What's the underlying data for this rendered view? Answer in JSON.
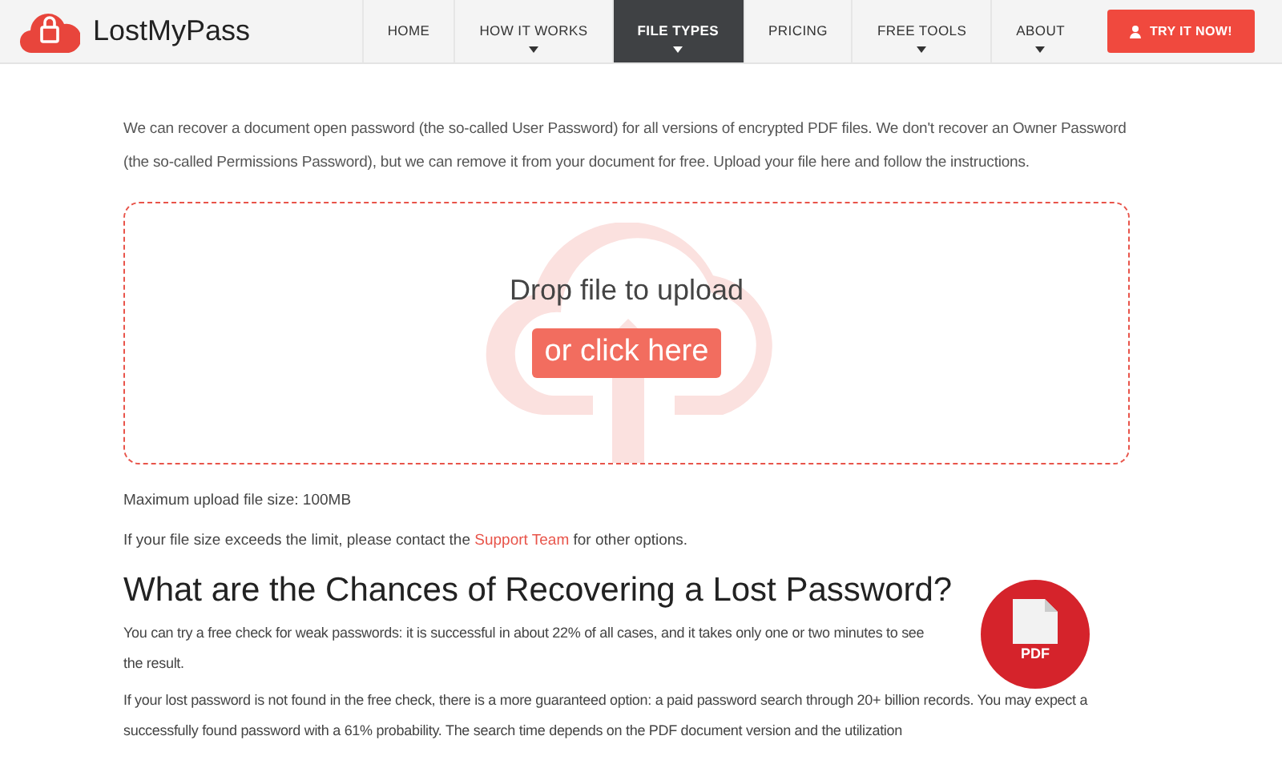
{
  "logo": {
    "text": "LostMyPass"
  },
  "nav": [
    {
      "label": "HOME",
      "selected": false,
      "dropdown": false
    },
    {
      "label": "HOW IT WORKS",
      "selected": false,
      "dropdown": true
    },
    {
      "label": "FILE TYPES",
      "selected": true,
      "dropdown": true
    },
    {
      "label": "PRICING",
      "selected": false,
      "dropdown": false
    },
    {
      "label": "FREE TOOLS",
      "selected": false,
      "dropdown": true
    },
    {
      "label": "ABOUT",
      "selected": false,
      "dropdown": true
    }
  ],
  "cta": {
    "label": "TRY IT NOW!"
  },
  "intro": "We can recover a document open password (the so-called User Password) for all versions of encrypted PDF files. We don't recover an Owner Password (the so-called Permissions Password), but we can remove it from your document for free. Upload your file here and follow the instructions.",
  "dropzone": {
    "title": "Drop file to upload",
    "button": "or click here"
  },
  "max_size": "Maximum upload file size: 100MB",
  "limit_note": {
    "before": "If your file size exceeds the limit, please contact the",
    "link": "Support Team",
    "after": "for other options."
  },
  "heading": "What are the Chances of Recovering a Lost Password?",
  "pdf_badge": "PDF",
  "paragraphs": [
    "You can try a free check for weak passwords: it is successful in about 22% of all cases, and it takes only one or two minutes to see the result.",
    "If your lost password is not found in the free check, there is a more guaranteed option: a paid password search through 20+ billion records. You may expect a successfully found password with a 61% probability. The search time depends on the PDF document version and the utilization"
  ]
}
